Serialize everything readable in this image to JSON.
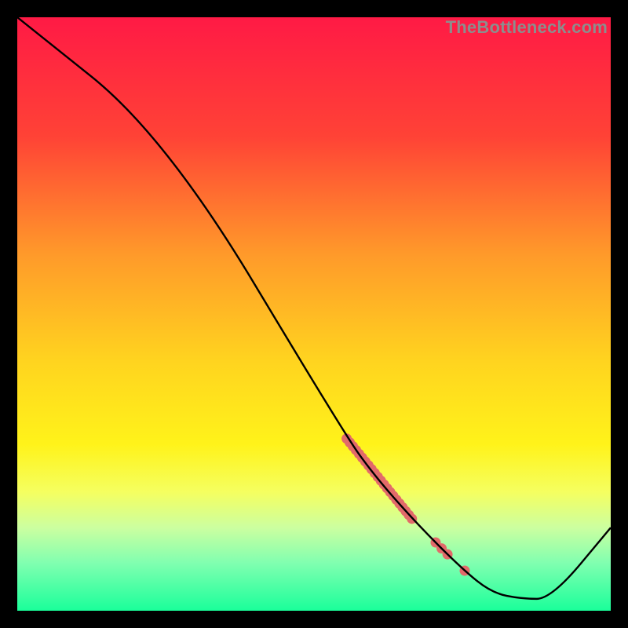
{
  "watermark": "TheBottleneck.com",
  "chart_data": {
    "type": "line",
    "title": "",
    "xlabel": "",
    "ylabel": "",
    "xlim": [
      0,
      100
    ],
    "ylim": [
      0,
      100
    ],
    "background_gradient_stops": [
      {
        "pct": 0,
        "color": "#ff1a45"
      },
      {
        "pct": 20,
        "color": "#ff4236"
      },
      {
        "pct": 40,
        "color": "#ff9a2a"
      },
      {
        "pct": 58,
        "color": "#ffd41f"
      },
      {
        "pct": 72,
        "color": "#fff31a"
      },
      {
        "pct": 80,
        "color": "#f5ff60"
      },
      {
        "pct": 86,
        "color": "#ccffa0"
      },
      {
        "pct": 92,
        "color": "#80ffb0"
      },
      {
        "pct": 100,
        "color": "#1aff9a"
      }
    ],
    "curve": {
      "x": [
        0,
        25,
        55,
        60,
        67,
        75,
        80,
        85,
        90,
        100
      ],
      "y": [
        100,
        80,
        30,
        23,
        15,
        7,
        3,
        2,
        2,
        14
      ]
    },
    "scatter_segments": [
      {
        "x0": 55.5,
        "y0": 29,
        "x1": 66.5,
        "y1": 15.5,
        "count": 22
      },
      {
        "x0": 70.5,
        "y0": 11.5,
        "x1": 72.5,
        "y1": 9.5,
        "count": 3
      },
      {
        "x0": 75.0,
        "y0": 7.0,
        "x1": 75.8,
        "y1": 6.5,
        "count": 1
      }
    ],
    "scatter_color": "#e26a6a",
    "curve_color": "#000000"
  }
}
